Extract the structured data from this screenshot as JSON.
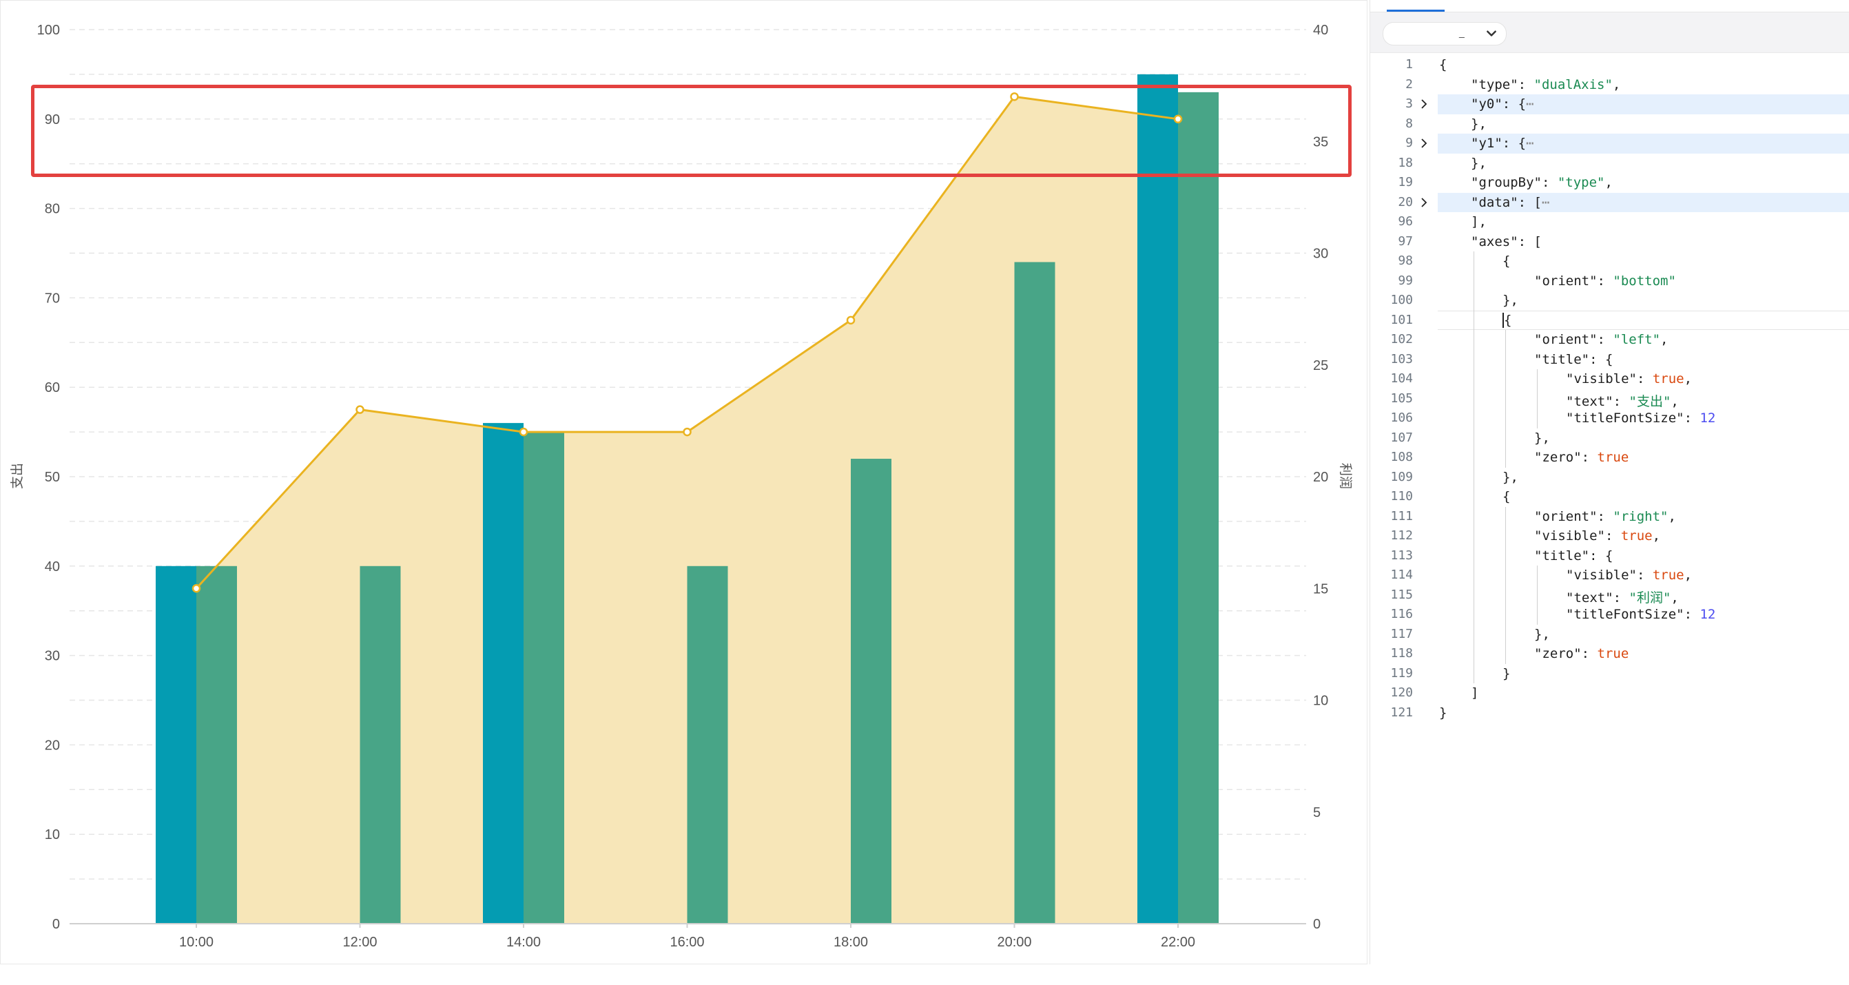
{
  "chart_data": {
    "type": "dualAxis",
    "categories": [
      "10:00",
      "12:00",
      "14:00",
      "16:00",
      "18:00",
      "20:00",
      "22:00"
    ],
    "bar_series": [
      {
        "color": "#049cb2",
        "values": [
          40,
          0,
          56,
          0,
          0,
          0,
          95
        ]
      },
      {
        "color": "#48a587",
        "values": [
          40,
          40,
          55,
          40,
          52,
          74,
          93
        ]
      }
    ],
    "area_series": {
      "color": "#eab320",
      "fill": "#f7e6b8",
      "values": [
        15,
        23,
        22,
        22,
        27,
        37,
        36
      ]
    },
    "y_left": {
      "title": "支出",
      "min": 0,
      "max": 100,
      "ticks": [
        "0",
        "10",
        "20",
        "30",
        "40",
        "50",
        "60",
        "70",
        "80",
        "90",
        "100"
      ]
    },
    "y_right": {
      "title": "利润",
      "min": 0,
      "max": 40,
      "ticks": [
        "0",
        "5",
        "10",
        "15",
        "20",
        "25",
        "30",
        "35",
        "40"
      ]
    }
  },
  "editor": {
    "select_value": "_",
    "lines": [
      {
        "no": "1",
        "indent": 0,
        "tokens": [
          [
            "punc",
            "{"
          ]
        ]
      },
      {
        "no": "2",
        "indent": 1,
        "tokens": [
          [
            "key",
            "\"type\""
          ],
          [
            "punc",
            ": "
          ],
          [
            "str",
            "\"dualAxis\""
          ],
          [
            "punc",
            ","
          ]
        ]
      },
      {
        "no": "3",
        "indent": 1,
        "fold": true,
        "tokens": [
          [
            "key",
            "\"y0\""
          ],
          [
            "punc",
            ": {"
          ],
          [
            "fold",
            "⋯"
          ]
        ]
      },
      {
        "no": "8",
        "indent": 1,
        "tokens": [
          [
            "punc",
            "},"
          ]
        ]
      },
      {
        "no": "9",
        "indent": 1,
        "fold": true,
        "tokens": [
          [
            "key",
            "\"y1\""
          ],
          [
            "punc",
            ": {"
          ],
          [
            "fold",
            "⋯"
          ]
        ]
      },
      {
        "no": "18",
        "indent": 1,
        "tokens": [
          [
            "punc",
            "},"
          ]
        ]
      },
      {
        "no": "19",
        "indent": 1,
        "tokens": [
          [
            "key",
            "\"groupBy\""
          ],
          [
            "punc",
            ": "
          ],
          [
            "str",
            "\"type\""
          ],
          [
            "punc",
            ","
          ]
        ]
      },
      {
        "no": "20",
        "indent": 1,
        "fold": true,
        "tokens": [
          [
            "key",
            "\"data\""
          ],
          [
            "punc",
            ": ["
          ],
          [
            "fold",
            "⋯"
          ]
        ]
      },
      {
        "no": "96",
        "indent": 1,
        "tokens": [
          [
            "punc",
            "],"
          ]
        ]
      },
      {
        "no": "97",
        "indent": 1,
        "tokens": [
          [
            "key",
            "\"axes\""
          ],
          [
            "punc",
            ": ["
          ]
        ]
      },
      {
        "no": "98",
        "indent": 2,
        "tokens": [
          [
            "punc",
            "{"
          ]
        ]
      },
      {
        "no": "99",
        "indent": 3,
        "tokens": [
          [
            "key",
            "\"orient\""
          ],
          [
            "punc",
            ": "
          ],
          [
            "str",
            "\"bottom\""
          ]
        ]
      },
      {
        "no": "100",
        "indent": 2,
        "tokens": [
          [
            "punc",
            "},"
          ]
        ]
      },
      {
        "no": "101",
        "indent": 2,
        "current": true,
        "tokens": [
          [
            "cursor",
            "{"
          ]
        ]
      },
      {
        "no": "102",
        "indent": 3,
        "tokens": [
          [
            "key",
            "\"orient\""
          ],
          [
            "punc",
            ": "
          ],
          [
            "str",
            "\"left\""
          ],
          [
            "punc",
            ","
          ]
        ]
      },
      {
        "no": "103",
        "indent": 3,
        "tokens": [
          [
            "key",
            "\"title\""
          ],
          [
            "punc",
            ": {"
          ]
        ]
      },
      {
        "no": "104",
        "indent": 4,
        "tokens": [
          [
            "key",
            "\"visible\""
          ],
          [
            "punc",
            ": "
          ],
          [
            "bool",
            "true"
          ],
          [
            "punc",
            ","
          ]
        ]
      },
      {
        "no": "105",
        "indent": 4,
        "tokens": [
          [
            "key",
            "\"text\""
          ],
          [
            "punc",
            ": "
          ],
          [
            "str",
            "\"支出\""
          ],
          [
            "punc",
            ","
          ]
        ]
      },
      {
        "no": "106",
        "indent": 4,
        "tokens": [
          [
            "key",
            "\"titleFontSize\""
          ],
          [
            "punc",
            ": "
          ],
          [
            "num",
            "12"
          ]
        ]
      },
      {
        "no": "107",
        "indent": 3,
        "tokens": [
          [
            "punc",
            "},"
          ]
        ]
      },
      {
        "no": "108",
        "indent": 3,
        "tokens": [
          [
            "key",
            "\"zero\""
          ],
          [
            "punc",
            ": "
          ],
          [
            "bool",
            "true"
          ]
        ]
      },
      {
        "no": "109",
        "indent": 2,
        "tokens": [
          [
            "punc",
            "},"
          ]
        ]
      },
      {
        "no": "110",
        "indent": 2,
        "tokens": [
          [
            "punc",
            "{"
          ]
        ]
      },
      {
        "no": "111",
        "indent": 3,
        "tokens": [
          [
            "key",
            "\"orient\""
          ],
          [
            "punc",
            ": "
          ],
          [
            "str",
            "\"right\""
          ],
          [
            "punc",
            ","
          ]
        ]
      },
      {
        "no": "112",
        "indent": 3,
        "tokens": [
          [
            "key",
            "\"visible\""
          ],
          [
            "punc",
            ": "
          ],
          [
            "bool",
            "true"
          ],
          [
            "punc",
            ","
          ]
        ]
      },
      {
        "no": "113",
        "indent": 3,
        "tokens": [
          [
            "key",
            "\"title\""
          ],
          [
            "punc",
            ": {"
          ]
        ]
      },
      {
        "no": "114",
        "indent": 4,
        "tokens": [
          [
            "key",
            "\"visible\""
          ],
          [
            "punc",
            ": "
          ],
          [
            "bool",
            "true"
          ],
          [
            "punc",
            ","
          ]
        ]
      },
      {
        "no": "115",
        "indent": 4,
        "tokens": [
          [
            "key",
            "\"text\""
          ],
          [
            "punc",
            ": "
          ],
          [
            "str",
            "\"利润\""
          ],
          [
            "punc",
            ","
          ]
        ]
      },
      {
        "no": "116",
        "indent": 4,
        "tokens": [
          [
            "key",
            "\"titleFontSize\""
          ],
          [
            "punc",
            ": "
          ],
          [
            "num",
            "12"
          ]
        ]
      },
      {
        "no": "117",
        "indent": 3,
        "tokens": [
          [
            "punc",
            "},"
          ]
        ]
      },
      {
        "no": "118",
        "indent": 3,
        "tokens": [
          [
            "key",
            "\"zero\""
          ],
          [
            "punc",
            ": "
          ],
          [
            "bool",
            "true"
          ]
        ]
      },
      {
        "no": "119",
        "indent": 2,
        "tokens": [
          [
            "punc",
            "}"
          ]
        ]
      },
      {
        "no": "120",
        "indent": 1,
        "tokens": [
          [
            "punc",
            "]"
          ]
        ]
      },
      {
        "no": "121",
        "indent": 0,
        "tokens": [
          [
            "punc",
            "}"
          ]
        ]
      }
    ]
  }
}
